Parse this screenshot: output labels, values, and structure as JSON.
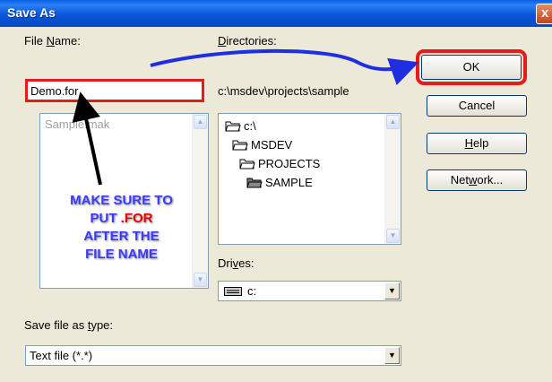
{
  "window": {
    "title": "Save As",
    "close_glyph": "x"
  },
  "file_name": {
    "label_pre": "File ",
    "label_key": "N",
    "label_post": "ame:",
    "value": "Demo.for",
    "files": [
      "Sample.mak"
    ]
  },
  "directories": {
    "label_key": "D",
    "label_post": "irectories:",
    "path": "c:\\msdev\\projects\\sample",
    "tree": [
      {
        "name": "c:\\",
        "icon": "open-folder-icon"
      },
      {
        "name": "MSDEV",
        "icon": "open-folder-icon"
      },
      {
        "name": "PROJECTS",
        "icon": "open-folder-icon"
      },
      {
        "name": "SAMPLE",
        "icon": "open-folder-icon"
      }
    ]
  },
  "drives": {
    "label_pre": "Dri",
    "label_key": "v",
    "label_post": "es:",
    "value": "c:",
    "icon": "drive-icon"
  },
  "file_type": {
    "label_pre": "Save file as ",
    "label_key": "t",
    "label_post": "ype:",
    "value": "Text file (*.*)"
  },
  "buttons": {
    "ok": "OK",
    "cancel": "Cancel",
    "help_key": "H",
    "help_rest": "elp",
    "network_pre": "Net",
    "network_key": "w",
    "network_post": "ork..."
  },
  "annotation": {
    "lines": [
      "MAKE SURE TO",
      "PUT ",
      ".FOR",
      "AFTER THE",
      "FILE NAME"
    ],
    "highlight_color": "#ff0000",
    "arrow_color": "#1f2fe0"
  }
}
